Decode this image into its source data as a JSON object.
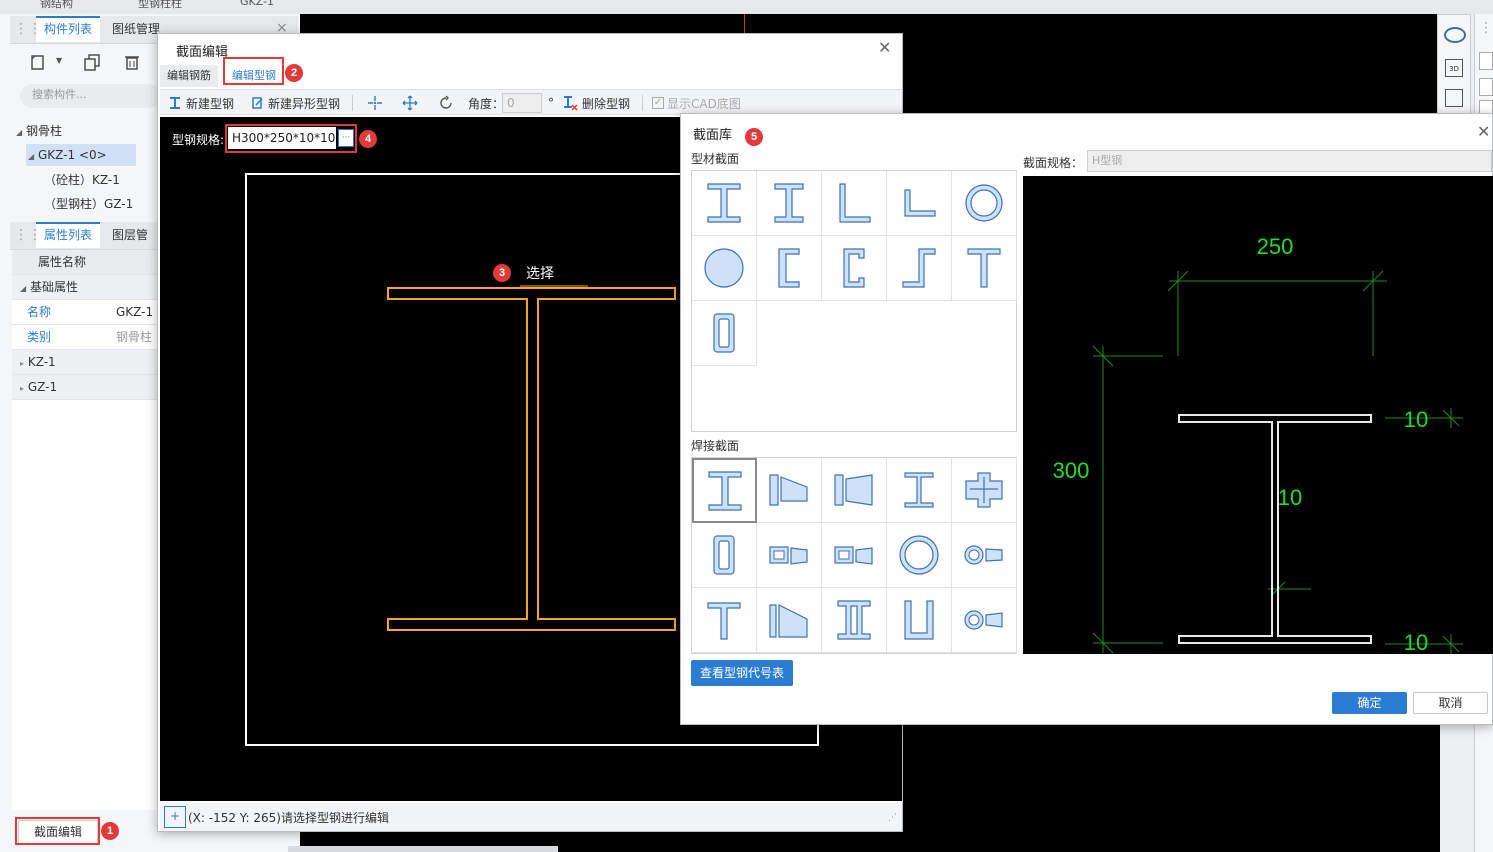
{
  "top_strip": [
    "钢结构",
    "型钢柱柱",
    "GKZ-1"
  ],
  "left_panel": {
    "tabs": [
      "构件列表",
      "图纸管理"
    ],
    "search_placeholder": "搜索构件...",
    "tree": {
      "root": "钢骨柱",
      "selected": "GKZ-1 <0>",
      "children": [
        "（砼柱）KZ-1",
        "（型钢柱）GZ-1"
      ]
    },
    "prop_tabs": [
      "属性列表",
      "图层管理"
    ],
    "prop_header": "属性名称",
    "group": "基础属性",
    "rows": [
      {
        "label": "名称",
        "value": "GKZ-1"
      },
      {
        "label": "类别",
        "value": "钢骨柱"
      }
    ],
    "collapsed": [
      "KZ-1",
      "GZ-1"
    ],
    "bottom_button": "截面编辑"
  },
  "section_editor": {
    "title": "截面编辑",
    "tabs": [
      "编辑钢筋",
      "编辑型钢"
    ],
    "toolbar": {
      "new_steel": "新建型钢",
      "new_special": "新建异形型钢",
      "angle_label": "角度：",
      "angle_value": "0",
      "degree": "°",
      "delete_steel": "删除型钢",
      "show_cad": "显示CAD底图"
    },
    "spec_label": "型钢规格:",
    "spec_value": "H300*250*10*10",
    "spec_button": "···",
    "canvas_hint": "选择",
    "status": "(X: -152 Y: 265)请选择型钢进行编辑"
  },
  "library": {
    "title": "截面库",
    "profile_label": "型材截面",
    "welded_label": "焊接截面",
    "spec_label": "截面规格：",
    "spec_value": "H型钢",
    "view_button": "查看型钢代号表",
    "ok": "确定",
    "cancel": "取消",
    "dims": {
      "width": "250",
      "height": "300",
      "flange_top": "10",
      "flange_bottom": "10",
      "web": "10"
    }
  },
  "badges": [
    "1",
    "2",
    "3",
    "4",
    "5"
  ],
  "colors": {
    "accent": "#2b7cd3",
    "highlight": "#e23a3a",
    "steel_outline": "#f5a623",
    "dim_green": "#22cc22"
  }
}
